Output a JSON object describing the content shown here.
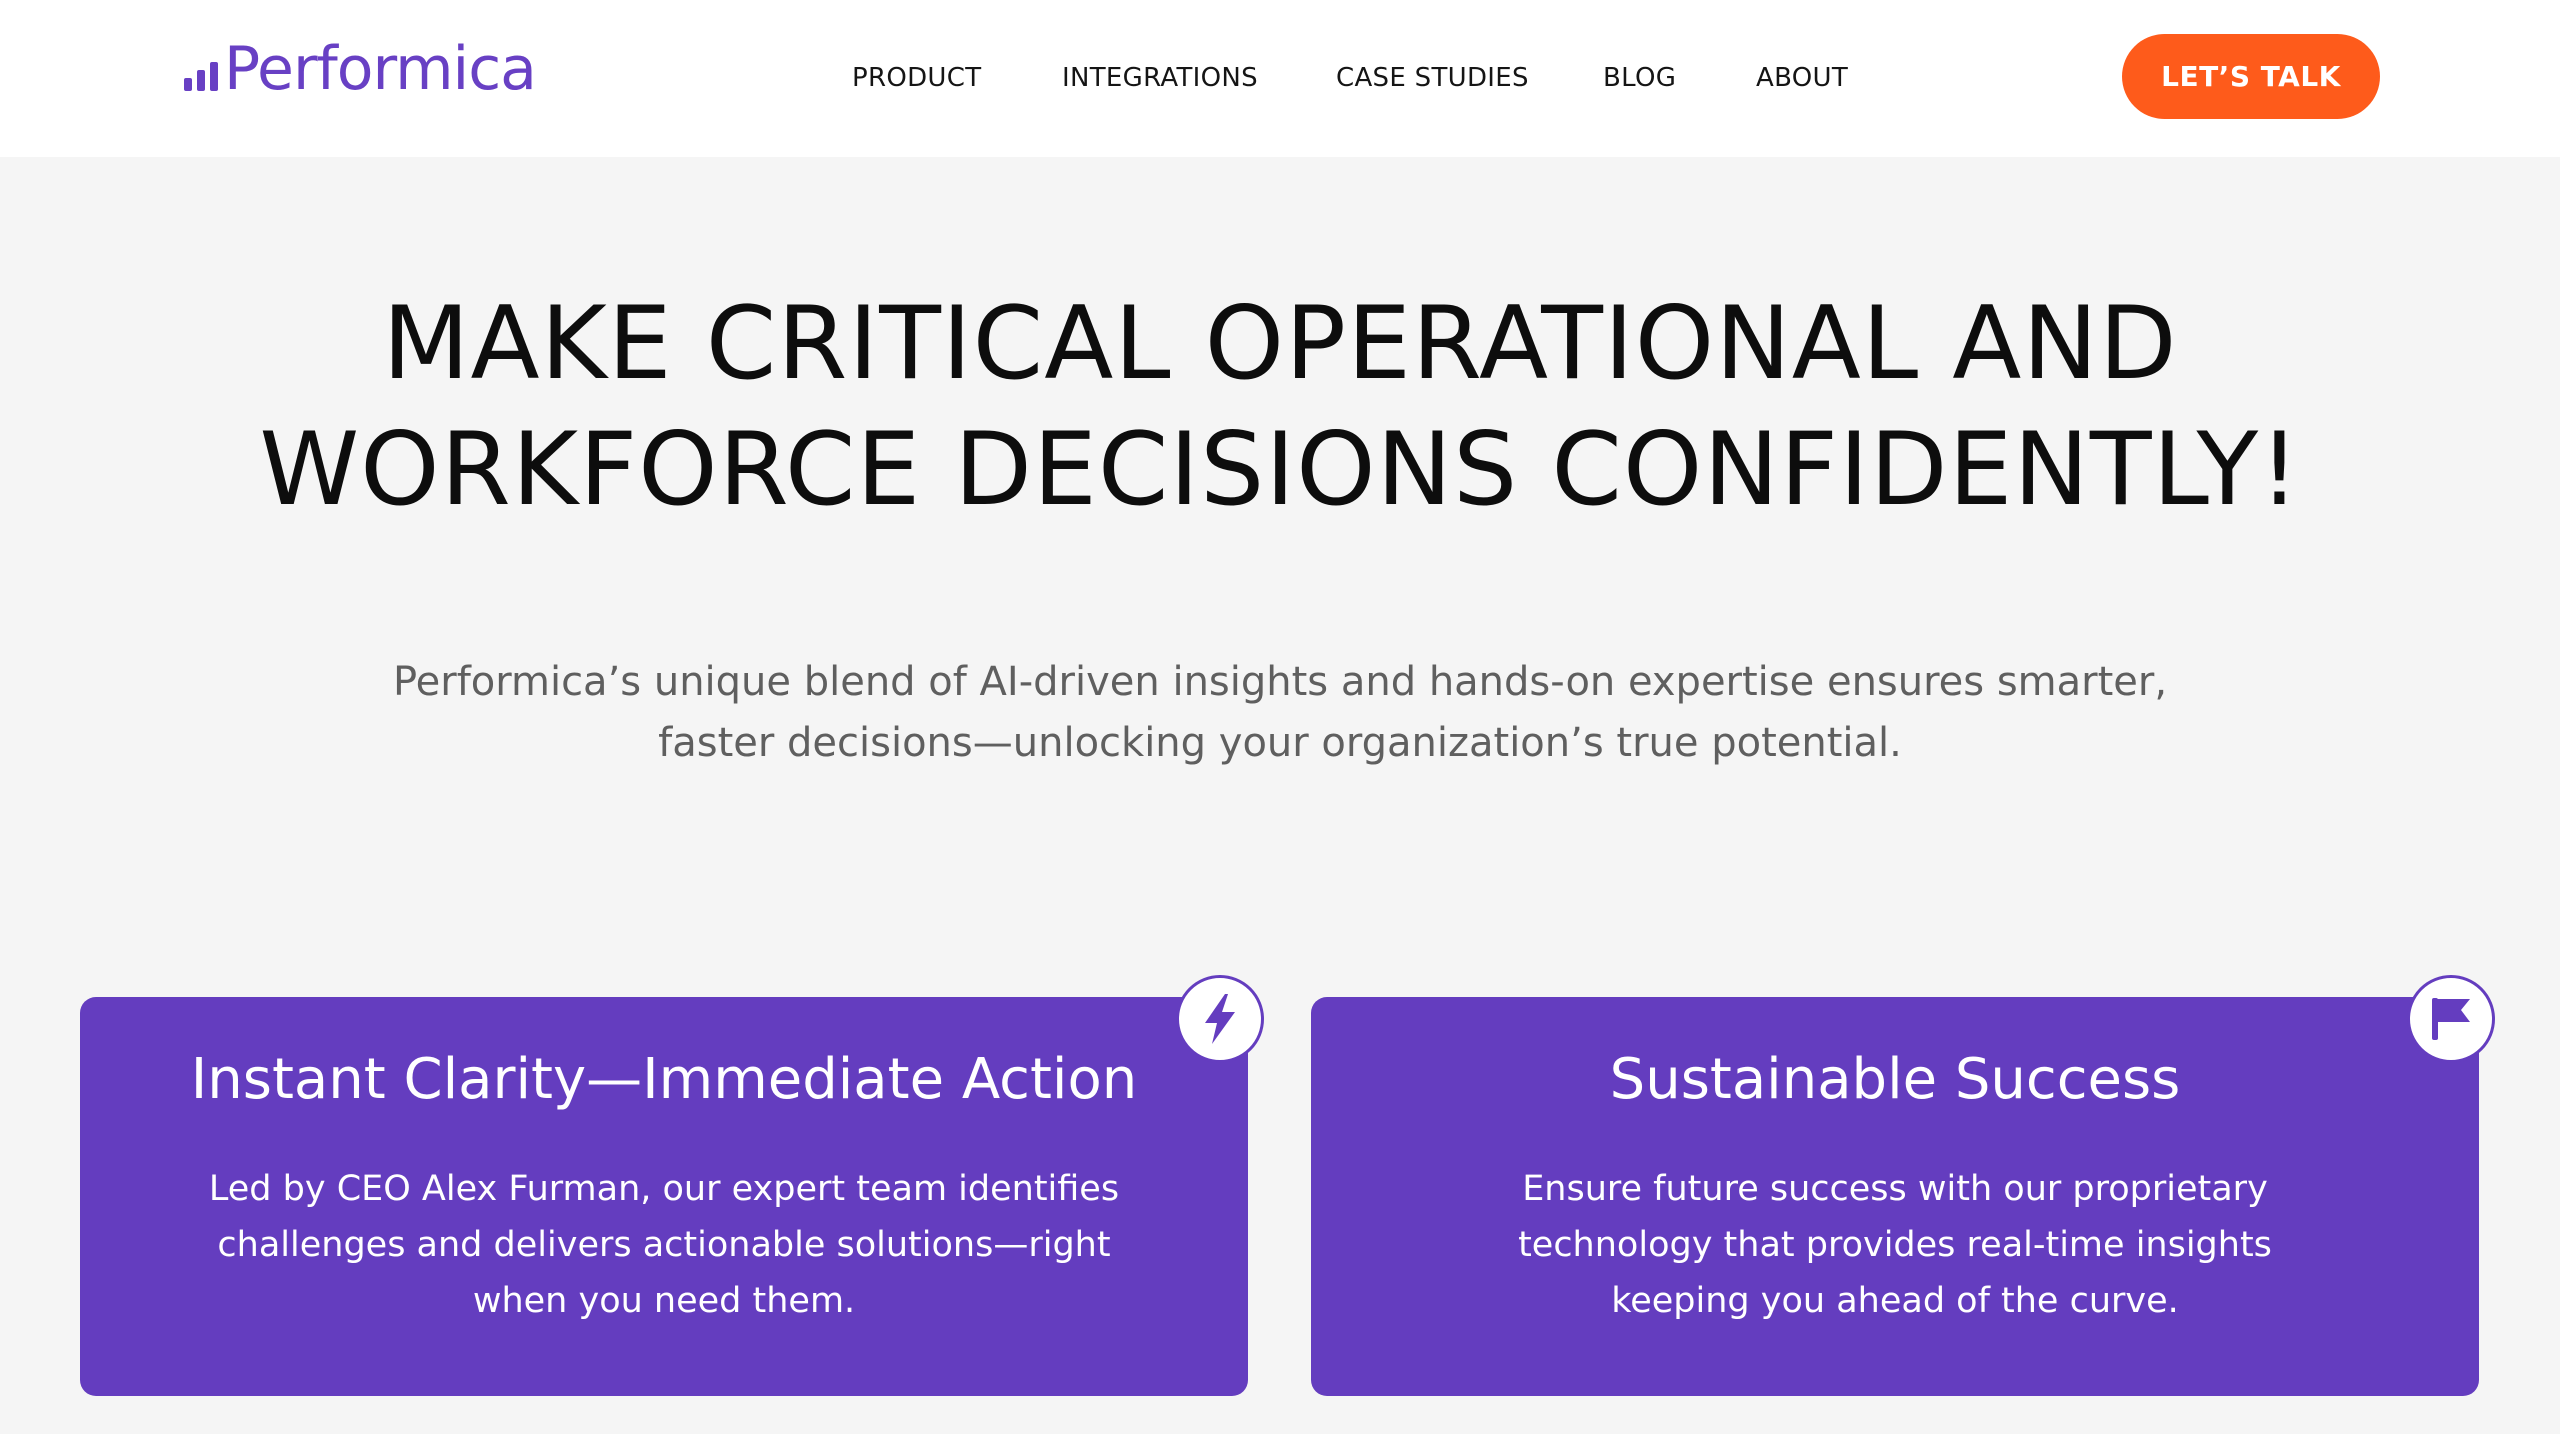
{
  "header": {
    "logo_text": "Performica",
    "nav": [
      {
        "label": "PRODUCT"
      },
      {
        "label": "INTEGRATIONS"
      },
      {
        "label": "CASE STUDIES"
      },
      {
        "label": "BLOG"
      },
      {
        "label": "ABOUT"
      }
    ],
    "cta_label": "LET’S TALK"
  },
  "hero": {
    "headline_lines": [
      "MAKE CRITICAL OPERATIONAL AND",
      "WORKFORCE DECISIONS CONFIDENTLY!"
    ],
    "subtext_lines": [
      "Performica’s unique blend of AI-driven insights and hands-on expertise ensures smarter,",
      "faster decisions—unlocking your organization’s true potential."
    ]
  },
  "cards": [
    {
      "title": "Instant Clarity—Immediate Action",
      "text_lines": [
        "Led by CEO Alex Furman, our expert team identifies",
        "challenges and delivers actionable solutions—right",
        "when you need them."
      ],
      "icon": "lightning-bolt-icon"
    },
    {
      "title": "Sustainable Success",
      "text_lines": [
        "Ensure future success with our proprietary",
        "technology that provides real-time insights",
        "keeping you ahead of the curve."
      ],
      "icon": "flag-icon"
    }
  ],
  "colors": {
    "brand_purple": "#6840c4",
    "card_purple": "#643dbf",
    "cta_orange": "#fe5b1b",
    "page_background": "#f5f5f5"
  }
}
